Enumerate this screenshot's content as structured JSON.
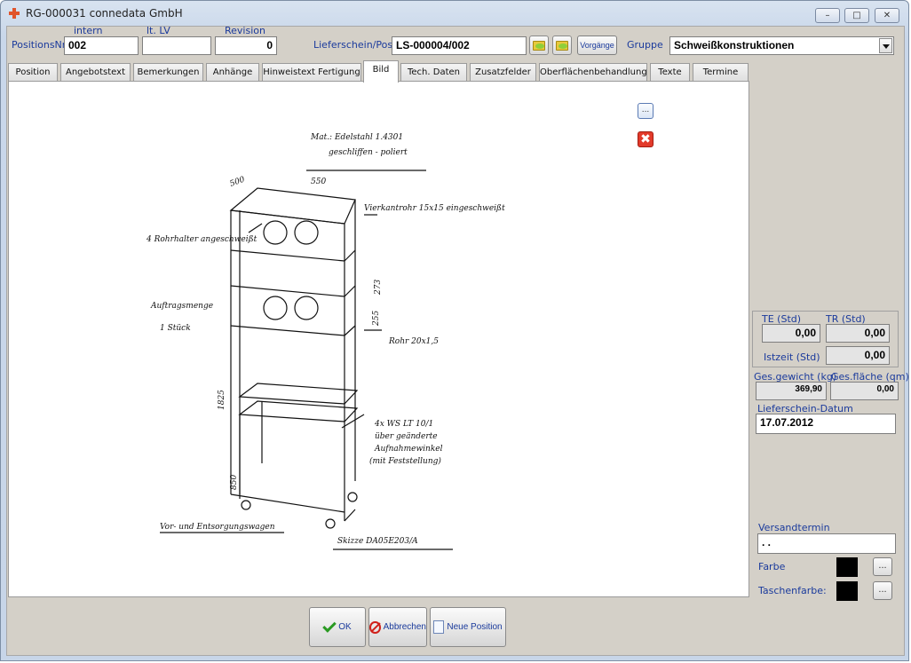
{
  "window": {
    "title": "RG-000031 connedata GmbH"
  },
  "header": {
    "positions_label": "PositionsNr",
    "positions_value": "002",
    "intern_label": "intern",
    "lt_lv_label": "lt. LV",
    "lt_lv_value": "",
    "revision_label": "Revision",
    "revision_value": "0",
    "lieferschein_label": "Lieferschein/Pos.",
    "lieferschein_value": "LS-000004/002",
    "vorgaenge_label": "Vorgänge",
    "gruppe_label": "Gruppe",
    "gruppe_value": "Schweißkonstruktionen"
  },
  "tabs": [
    {
      "label": "Position"
    },
    {
      "label": "Angebotstext"
    },
    {
      "label": "Bemerkungen"
    },
    {
      "label": "Anhänge"
    },
    {
      "label": "Hinweistext Fertigung"
    },
    {
      "label": "Bild"
    },
    {
      "label": "Tech. Daten"
    },
    {
      "label": "Zusatzfelder"
    },
    {
      "label": "Oberflächenbehandlung"
    },
    {
      "label": "Texte"
    },
    {
      "label": "Termine"
    }
  ],
  "image_panel": {
    "browse_label": "...",
    "drawing_text": {
      "material": "Mat.: Edelstahl 1.4301",
      "finish": "geschliffen - poliert",
      "width_dim": "550",
      "depth_dim": "500",
      "rod_note": "4 Rohrhalter angeschweißt",
      "tube_note": "Vierkantrohr 15x15 eingeschweißt",
      "height_dim_upper": "273",
      "height_dim_mid": "255",
      "tube_spec": "Rohr 20x1,5",
      "quantity_note": "Auftragsmenge",
      "quantity_value": "1 Stück",
      "total_height": "1825",
      "lower_height": "850",
      "wheel_note_1": "4x WS LT 10/1",
      "wheel_note_2": "über geänderte",
      "wheel_note_3": "Aufnahmewinkel",
      "wheel_note_4": "(mit Feststellung)",
      "title_block": "Vor- und Entsorgungswagen",
      "drawing_number": "Skizze DA05E203/A"
    }
  },
  "side": {
    "te_label": "TE (Std)",
    "te_value": "0,00",
    "tr_label": "TR (Std)",
    "tr_value": "0,00",
    "istzeit_label": "Istzeit (Std)",
    "istzeit_value": "0,00",
    "gewicht_label": "Ges.gewicht (kg)",
    "gewicht_value": "369,90",
    "flaeche_label": "Ges.fläche (qm)",
    "flaeche_value": "0,00",
    "ls_datum_label": "Lieferschein-Datum",
    "ls_datum_value": "17.07.2012",
    "versand_label": "Versandtermin",
    "versand_value": " .  .",
    "farbe_label": "Farbe",
    "farbe_button": "...",
    "taschen_label": "Taschenfarbe:",
    "taschen_button": "...",
    "swatch_color": "#000000"
  },
  "footer": {
    "ok_label": "OK",
    "cancel_label": "Abbrechen",
    "new_label": "Neue Position"
  }
}
